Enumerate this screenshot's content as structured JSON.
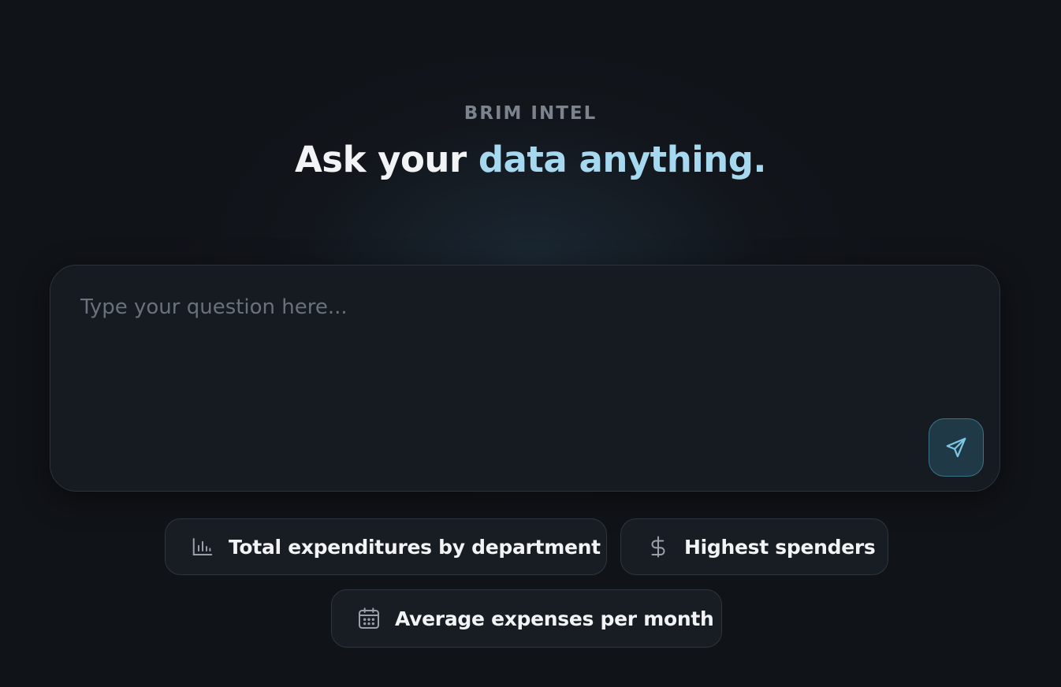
{
  "brand": {
    "eyebrow": "BRIM INTEL"
  },
  "headline": {
    "part1": "Ask your ",
    "part2": "data anything."
  },
  "query": {
    "placeholder": "Type your question here...",
    "value": ""
  },
  "send_button": {
    "icon": "send-icon"
  },
  "suggestions": [
    {
      "label": "Total expenditures by department",
      "icon": "bar-chart-icon"
    },
    {
      "label": "Highest spenders",
      "icon": "dollar-icon"
    },
    {
      "label": "Average expenses per month",
      "icon": "calendar-icon"
    }
  ],
  "colors": {
    "background": "#101318",
    "accent": "#a6d8ef",
    "send_icon": "#7cc7e6"
  }
}
